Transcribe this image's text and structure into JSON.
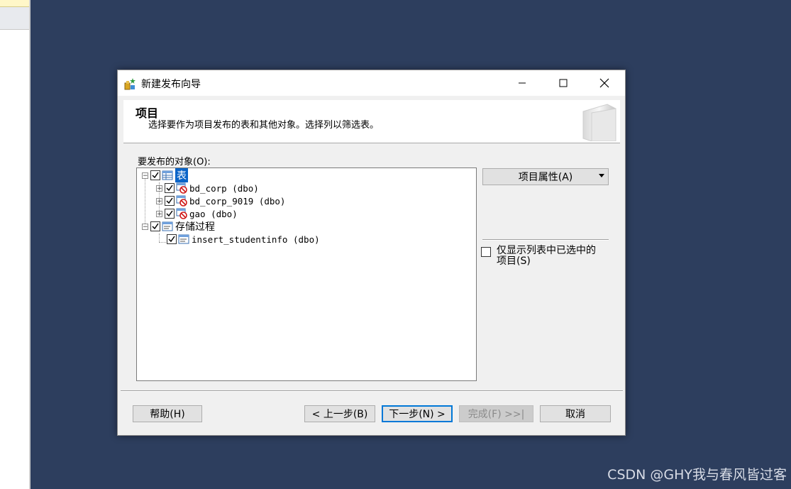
{
  "dialog": {
    "title": "新建发布向导",
    "header_title": "项目",
    "header_desc": "选择要作为项目发布的表和其他对象。选择列以筛选表。"
  },
  "objects": {
    "label": "要发布的对象(O):",
    "tree": [
      {
        "label": "表",
        "checked": true,
        "expanded": true,
        "selected": true,
        "icon": "table-folder-icon",
        "children": [
          {
            "label": "bd_corp (dbo)",
            "checked": true,
            "icon": "table-no-key-icon"
          },
          {
            "label": "bd_corp_9019 (dbo)",
            "checked": true,
            "icon": "table-no-key-icon"
          },
          {
            "label": "gao (dbo)",
            "checked": true,
            "icon": "table-no-key-icon"
          }
        ]
      },
      {
        "label": "存储过程",
        "checked": true,
        "expanded": true,
        "icon": "procedure-folder-icon",
        "children": [
          {
            "label": "insert_studentinfo (dbo)",
            "checked": true,
            "icon": "stored-procedure-icon"
          }
        ]
      }
    ]
  },
  "properties": {
    "button_label": "项目属性(A)"
  },
  "filter": {
    "show_checked_label_line1": "仅显示列表中已选中的",
    "show_checked_label_line2": "项目(S)",
    "checked": false
  },
  "buttons": {
    "help": "帮助(H)",
    "back": "< 上一步(B)",
    "next": "下一步(N) >",
    "finish": "完成(F) >>|",
    "cancel": "取消"
  },
  "watermark": "CSDN @GHY我与春风皆过客"
}
